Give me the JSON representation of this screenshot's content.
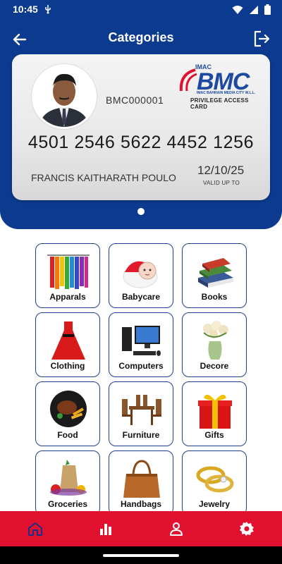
{
  "status_bar": {
    "time": "10:45"
  },
  "header": {
    "title": "Categories"
  },
  "card": {
    "member_id": "BMC000001",
    "logo": {
      "imac": "IMAC",
      "bmc": "BMC",
      "company": "IMAC BAHRAIN MEDIA CITY W.L.L.",
      "privilege": "PRIVILEGE ACCESS CARD"
    },
    "number": "4501 2546 5622 4452 1256",
    "holder_name": "FRANCIS KAITHARATH POULO",
    "expiry": "12/10/25",
    "valid_label": "VALID UP TO"
  },
  "categories": [
    {
      "label": "Apparals",
      "icon": "apparels-icon"
    },
    {
      "label": "Babycare",
      "icon": "babycare-icon"
    },
    {
      "label": "Books",
      "icon": "books-icon"
    },
    {
      "label": "Clothing",
      "icon": "clothing-icon"
    },
    {
      "label": "Computers",
      "icon": "computers-icon"
    },
    {
      "label": "Decore",
      "icon": "decore-icon"
    },
    {
      "label": "Food",
      "icon": "food-icon"
    },
    {
      "label": "Furniture",
      "icon": "furniture-icon"
    },
    {
      "label": "Gifts",
      "icon": "gifts-icon"
    },
    {
      "label": "Groceries",
      "icon": "groceries-icon"
    },
    {
      "label": "Handbags",
      "icon": "handbags-icon"
    },
    {
      "label": "Jewelry",
      "icon": "jewelry-icon"
    }
  ],
  "bottom_nav": [
    {
      "name": "home",
      "icon": "home-icon",
      "active": true
    },
    {
      "name": "stats",
      "icon": "chart-icon",
      "active": false
    },
    {
      "name": "profile",
      "icon": "person-icon",
      "active": false
    },
    {
      "name": "settings",
      "icon": "gear-icon",
      "active": false
    }
  ],
  "colors": {
    "primary": "#0b3a8f",
    "accent": "#e0102e",
    "tile_border": "#1f3f8f"
  }
}
